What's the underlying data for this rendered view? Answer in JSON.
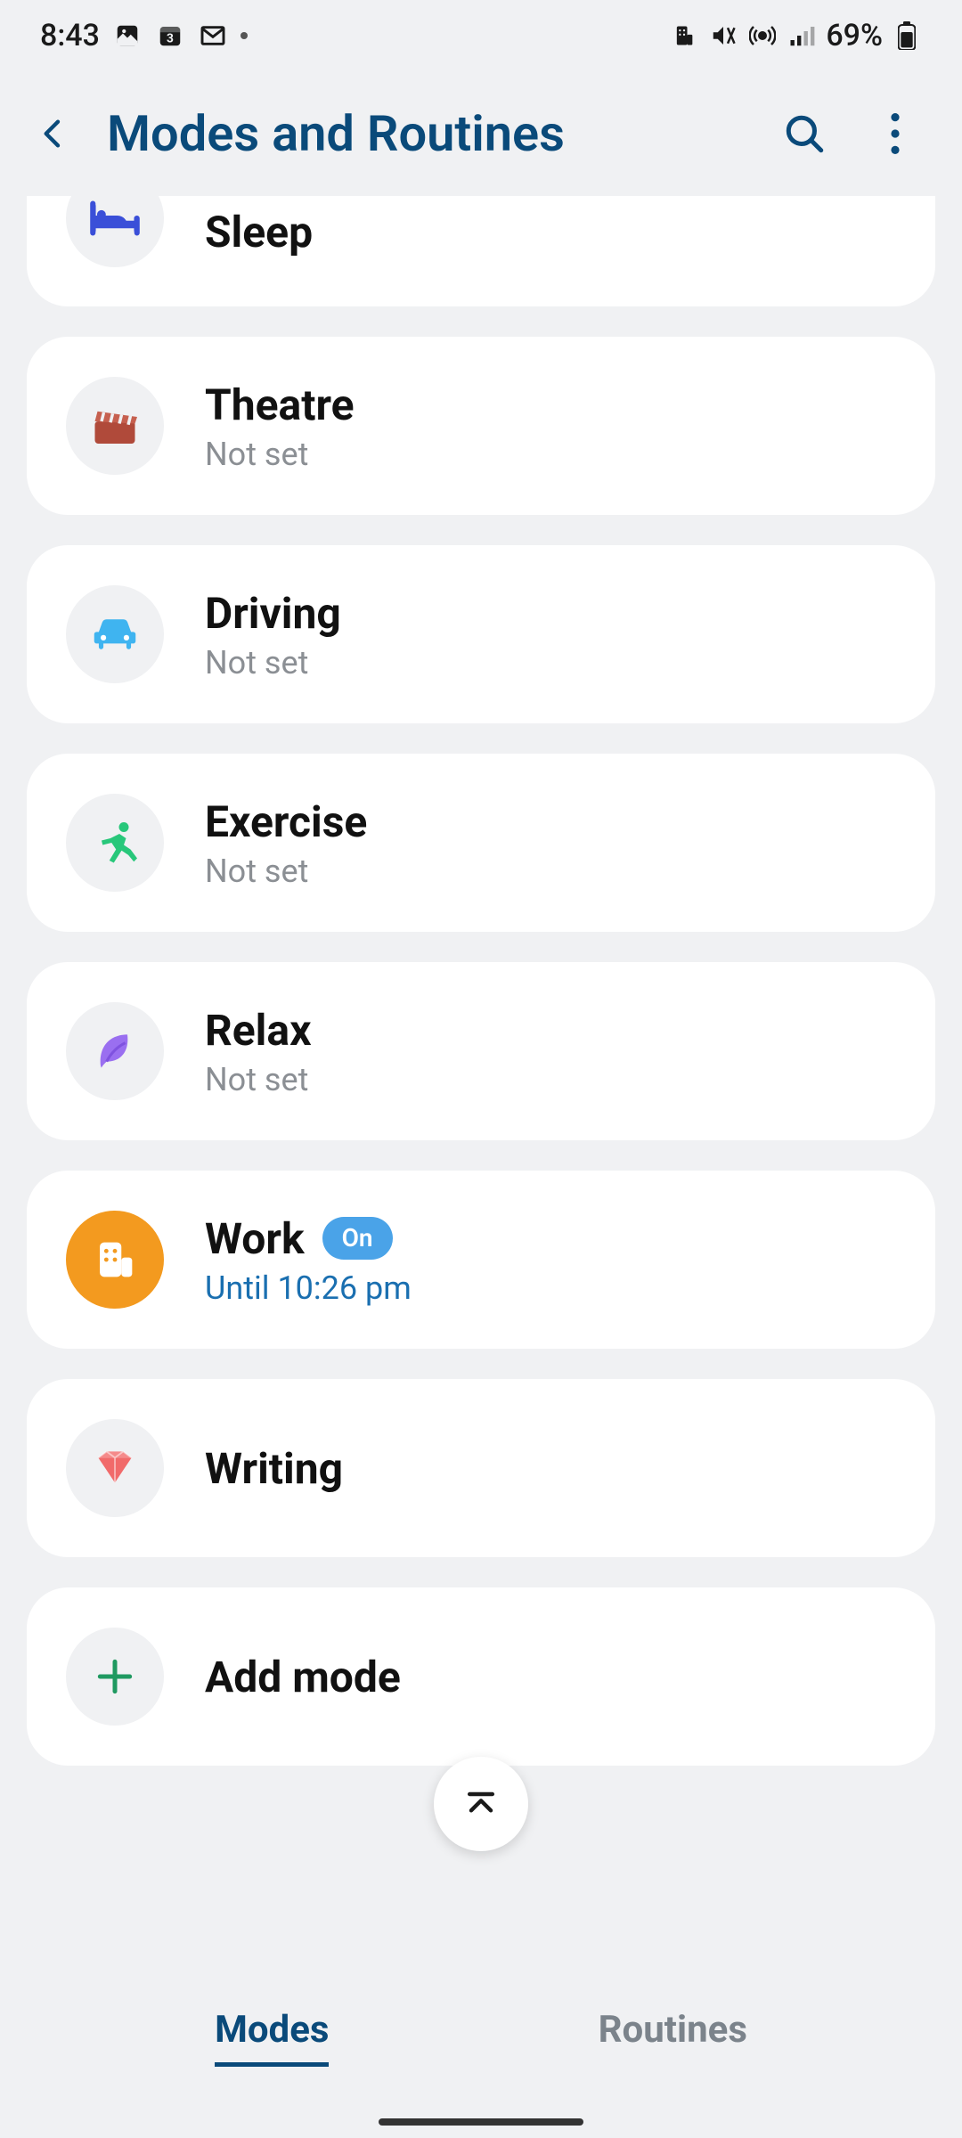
{
  "status": {
    "time": "8:43",
    "battery": "69%"
  },
  "header": {
    "title": "Modes and Routines"
  },
  "modes": {
    "sleep": {
      "title": "Sleep"
    },
    "theatre": {
      "title": "Theatre",
      "sub": "Not set"
    },
    "driving": {
      "title": "Driving",
      "sub": "Not set"
    },
    "exercise": {
      "title": "Exercise",
      "sub": "Not set"
    },
    "relax": {
      "title": "Relax",
      "sub": "Not set"
    },
    "work": {
      "title": "Work",
      "badge": "On",
      "sub": "Until 10:26  pm"
    },
    "writing": {
      "title": "Writing"
    },
    "add": {
      "title": "Add mode"
    }
  },
  "tabs": {
    "modes": "Modes",
    "routines": "Routines"
  }
}
